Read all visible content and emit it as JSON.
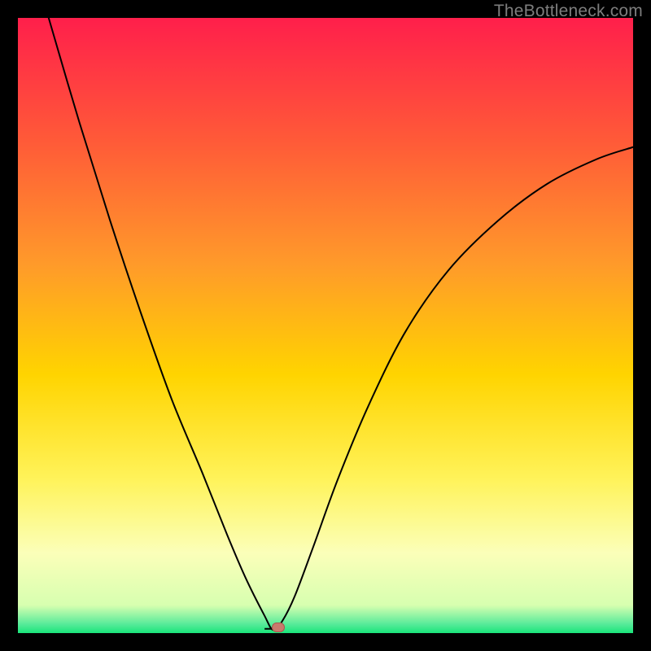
{
  "watermark": "TheBottleneck.com",
  "colors": {
    "top": "#ff1f4b",
    "upper_mid": "#ff8a2a",
    "mid": "#ffd400",
    "lower_mid": "#fff35a",
    "pale_yellow": "#fbffb9",
    "green": "#19e57a",
    "marker_fill": "#c97a6d",
    "marker_stroke": "#a85a4e",
    "curve": "#000000",
    "background": "#000000"
  },
  "chart_data": {
    "type": "line",
    "title": "",
    "xlabel": "",
    "ylabel": "",
    "xlim": [
      0,
      100
    ],
    "ylim": [
      0,
      100
    ],
    "grid": false,
    "legend": false,
    "notes": "V-shaped bottleneck curve on rainbow vertical gradient. Minimum near x≈42. No axis ticks or numeric labels visible.",
    "series": [
      {
        "name": "bottleneck-curve",
        "x": [
          5,
          10,
          15,
          20,
          25,
          30,
          34,
          37,
          40,
          41.5,
          43,
          45,
          48,
          52,
          57,
          63,
          70,
          78,
          86,
          94,
          100
        ],
        "y": [
          100,
          83,
          67,
          52,
          38,
          26,
          16,
          9,
          3,
          0.5,
          2,
          6,
          14,
          25,
          37,
          49,
          59,
          67,
          73,
          77,
          79
        ]
      }
    ],
    "marker": {
      "x": 42.3,
      "y": 0.9
    },
    "background_gradient_stops": [
      {
        "pos": 0.0,
        "color": "#ff1f4b"
      },
      {
        "pos": 0.2,
        "color": "#ff5a38"
      },
      {
        "pos": 0.4,
        "color": "#ff9a2a"
      },
      {
        "pos": 0.58,
        "color": "#ffd400"
      },
      {
        "pos": 0.75,
        "color": "#fff35a"
      },
      {
        "pos": 0.87,
        "color": "#fbffb9"
      },
      {
        "pos": 0.955,
        "color": "#d7ffb0"
      },
      {
        "pos": 0.985,
        "color": "#59eb9a"
      },
      {
        "pos": 1.0,
        "color": "#19e57a"
      }
    ]
  }
}
